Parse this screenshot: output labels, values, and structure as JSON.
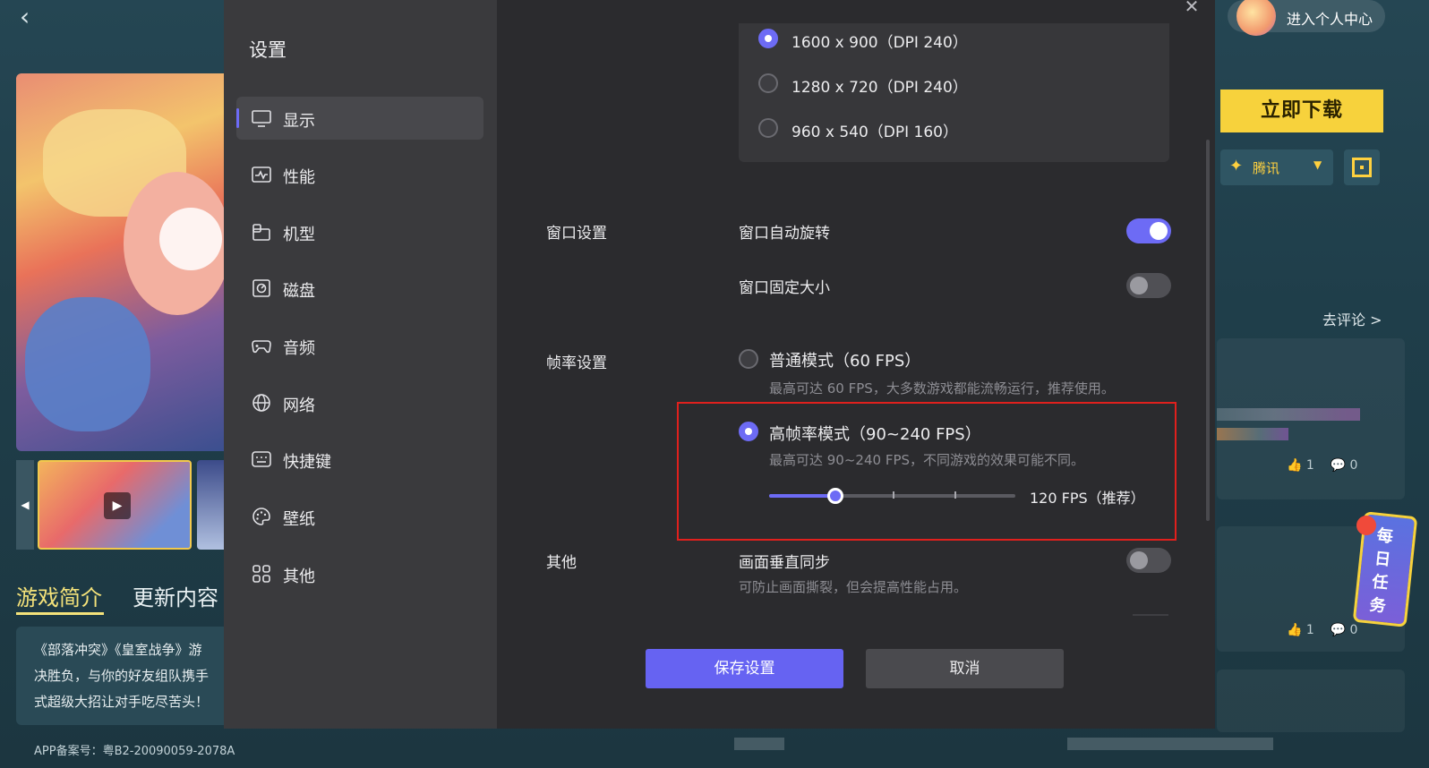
{
  "background": {
    "tabs": [
      "游戏简介",
      "更新内容"
    ],
    "intro_lines": [
      "《部落冲突》《皇室战争》游",
      "决胜负，与你的好友组队携手",
      "式超级大招让对手吃尽苦头！"
    ],
    "icp": "APP备案号：粤B2-20090059-2078A",
    "user_center": "进入个人中心",
    "download": "立即下载",
    "channel": "腾讯",
    "comment_link": "去评论 >",
    "likes_1": "1",
    "comments_1": "0",
    "likes_2": "1",
    "comments_2": "0",
    "task_badge": "每日任务"
  },
  "modal": {
    "title": "设置",
    "nav": [
      {
        "label": "显示",
        "icon": "monitor-icon",
        "active": true
      },
      {
        "label": "性能",
        "icon": "performance-icon",
        "active": false
      },
      {
        "label": "机型",
        "icon": "device-model-icon",
        "active": false
      },
      {
        "label": "磁盘",
        "icon": "disk-icon",
        "active": false
      },
      {
        "label": "音频",
        "icon": "gamepad-icon",
        "active": false
      },
      {
        "label": "网络",
        "icon": "globe-icon",
        "active": false
      },
      {
        "label": "快捷键",
        "icon": "keyboard-icon",
        "active": false
      },
      {
        "label": "壁纸",
        "icon": "palette-icon",
        "active": false
      },
      {
        "label": "其他",
        "icon": "grid-icon",
        "active": false
      }
    ],
    "resolutions": [
      {
        "label": "1600 x 900（DPI 240）",
        "selected": true
      },
      {
        "label": "1280 x 720（DPI 240）",
        "selected": false
      },
      {
        "label": "960 x 540（DPI 160）",
        "selected": false
      }
    ],
    "window": {
      "section": "窗口设置",
      "auto_rotate_label": "窗口自动旋转",
      "auto_rotate_on": true,
      "fixed_size_label": "窗口固定大小",
      "fixed_size_on": false
    },
    "fps": {
      "section": "帧率设置",
      "normal_title": "普通模式（60 FPS）",
      "normal_desc": "最高可达 60 FPS，大多数游戏都能流畅运行，推荐使用。",
      "normal_selected": false,
      "high_title": "高帧率模式（90~240 FPS）",
      "high_desc": "最高可达 90~240 FPS，不同游戏的效果可能不同。",
      "high_selected": true,
      "slider_value": "120 FPS（推荐）",
      "slider_fraction": 0.27
    },
    "other": {
      "section": "其他",
      "vsync_label": "画面垂直同步",
      "vsync_desc": "可防止画面撕裂，但会提高性能占用。",
      "vsync_on": false
    },
    "buttons": {
      "save": "保存设置",
      "cancel": "取消"
    },
    "highlight_color": "#e0201d",
    "accent_color": "#6d6bf5"
  }
}
